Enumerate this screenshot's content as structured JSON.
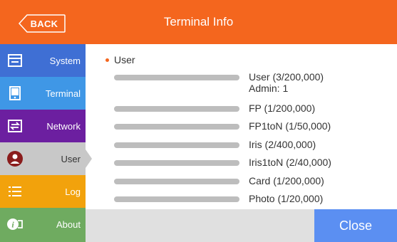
{
  "header": {
    "back_label": "BACK",
    "title": "Terminal Info",
    "color": "#f4661e"
  },
  "sidebar": {
    "items": [
      {
        "label": "System",
        "icon": "system-settings-icon",
        "color": "#3f6fd4",
        "active": false
      },
      {
        "label": "Terminal",
        "icon": "terminal-device-icon",
        "color": "#3f97e6",
        "active": false
      },
      {
        "label": "Network",
        "icon": "network-icon",
        "color": "#6c1fa0",
        "active": false
      },
      {
        "label": "User",
        "icon": "user-icon",
        "color": "#c8c8c8",
        "active": true
      },
      {
        "label": "Log",
        "icon": "list-icon",
        "color": "#f2a20c",
        "active": false
      },
      {
        "label": "About",
        "icon": "info-icon",
        "color": "#6fab60",
        "active": false
      }
    ]
  },
  "content": {
    "section_title": "User",
    "rows": [
      {
        "text": "User (3/200,000)",
        "sub": "Admin: 1"
      },
      {
        "text": "FP (1/200,000)"
      },
      {
        "text": "FP1toN (1/50,000)"
      },
      {
        "text": "Iris (2/400,000)"
      },
      {
        "text": "Iris1toN (2/40,000)"
      },
      {
        "text": "Card (1/200,000)"
      },
      {
        "text": "Photo (1/20,000)"
      }
    ]
  },
  "footer": {
    "close_label": "Close",
    "close_color": "#5b8ff2"
  }
}
